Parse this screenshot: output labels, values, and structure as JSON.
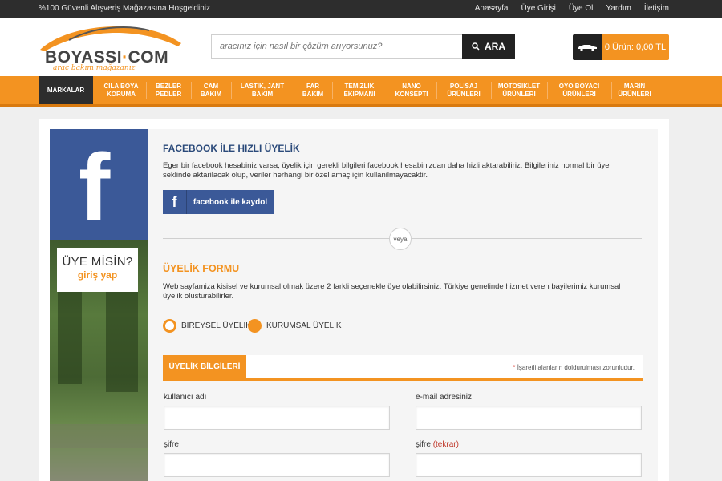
{
  "topbar": {
    "welcome": "%100 Güvenli Alışveriş Mağazasına Hoşgeldiniz",
    "links": [
      "Anasayfa",
      "Üye Girişi",
      "Üye Ol",
      "Yardım",
      "İletişim"
    ]
  },
  "header": {
    "logo_text_1": "BOYASSI",
    "logo_text_dot": "·",
    "logo_text_2": "COM",
    "logo_tagline": "araç bakım mağazanız",
    "search_placeholder": "aracınız için nasıl bir çözüm arıyorsunuz?",
    "search_button": "ARA",
    "cart_text": "0 Ürün: 0,00 TL"
  },
  "nav": {
    "items": [
      "MARKALAR",
      "CİLA BOYA KORUMA",
      "BEZLER PEDLER",
      "CAM BAKIM",
      "LASTİK, JANT BAKIM",
      "FAR BAKIM",
      "TEMİZLİK EKİPMANI",
      "NANO KONSEPTİ",
      "POLİSAJ ÜRÜNLERİ",
      "MOTOSİKLET ÜRÜNLERİ",
      "OYO BOYACI ÜRÜNLERİ",
      "MARİN ÜRÜNLERİ"
    ]
  },
  "sidebar": {
    "fb_letter": "f",
    "member_question": "ÜYE MİSİN?",
    "member_login": "giriş yap"
  },
  "facebook": {
    "heading": "FACEBOOK İLE HIZLI ÜYELİK",
    "text": "Eger bir facebook hesabiniz varsa, üyelik için gerekli bilgileri facebook hesabinizdan daha hizli aktarabiliriz. Bilgileriniz normal bir üye seklinde aktarilacak olup, veriler herhangi bir özel amaç için kullanilmayacaktir.",
    "button_icon": "f",
    "button_label": "facebook ile kaydol",
    "divider_text": "veya"
  },
  "form": {
    "heading": "ÜYELİK FORMU",
    "text": "Web sayfamiza kisisel ve kurumsal olmak üzere 2 farkli seçenekle üye olabilirsiniz. Türkiye genelinde hizmet veren bayilerimiz kurumsal üyelik olusturabilirler.",
    "radio_individual": "BİREYSEL ÜYELİK",
    "radio_corporate": "KURUMSAL ÜYELİK",
    "selected": "BİREYSEL ÜYELİK",
    "section_tab": "ÜYELİK BİLGİLERİ",
    "required_star": "*",
    "required_note": " İşaretli alanların doldurulması zorunludur.",
    "fields": {
      "username_label": "kullanıcı adı",
      "email_label": "e-mail adresiniz",
      "password_label": "şifre",
      "password_repeat_label": "şifre",
      "password_repeat_suffix": "(tekrar)",
      "username_value": "",
      "email_value": "",
      "password_value": "",
      "password_repeat_value": ""
    }
  },
  "colors": {
    "accent": "#f39321",
    "dark": "#2d2d2d",
    "facebook": "#3b5998"
  }
}
